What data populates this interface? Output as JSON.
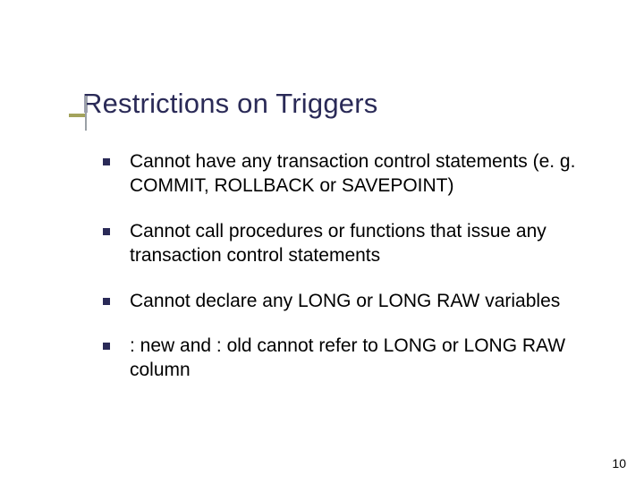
{
  "title": "Restrictions on Triggers",
  "bullets": [
    "Cannot have any transaction control statements (e. g. COMMIT, ROLLBACK or SAVEPOINT)",
    "Cannot call procedures or functions that issue any transaction control statements",
    "Cannot declare any LONG or LONG RAW variables",
    ": new and : old cannot refer to LONG or LONG RAW column"
  ],
  "page_number": "10"
}
